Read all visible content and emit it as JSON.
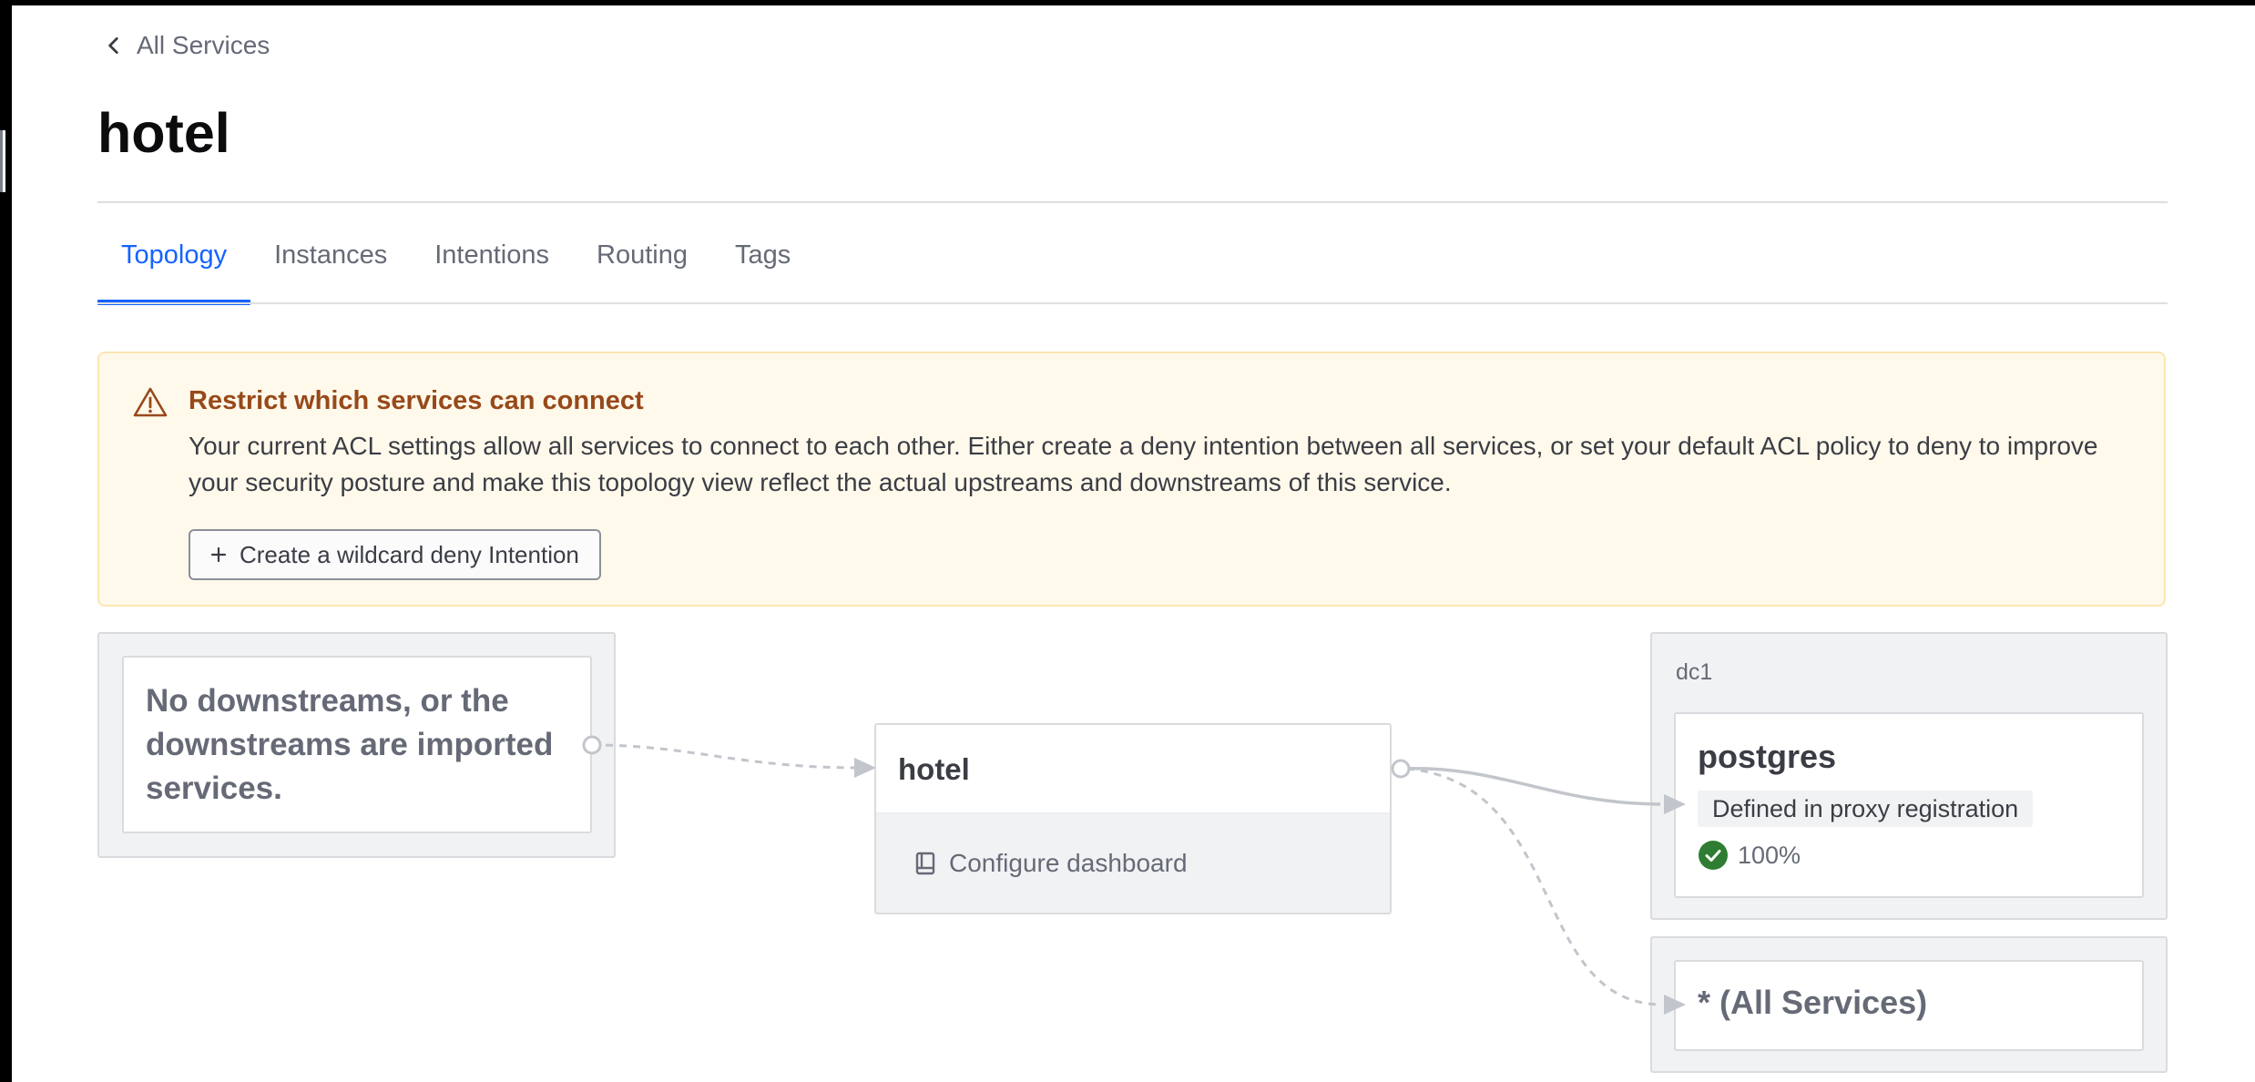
{
  "breadcrumb": {
    "label": "All Services"
  },
  "page": {
    "title": "hotel"
  },
  "tabs": [
    {
      "label": "Topology",
      "active": true
    },
    {
      "label": "Instances",
      "active": false
    },
    {
      "label": "Intentions",
      "active": false
    },
    {
      "label": "Routing",
      "active": false
    },
    {
      "label": "Tags",
      "active": false
    }
  ],
  "notice": {
    "icon": "warning-icon",
    "title": "Restrict which services can connect",
    "body": "Your current ACL settings allow all services to connect to each other. Either create a deny intention between all services, or set your default ACL policy to deny to improve your security posture and make this topology view reflect the actual upstreams and downstreams of this service.",
    "button_label": "Create a wildcard deny Intention",
    "button_icon": "plus-icon"
  },
  "topology": {
    "downstream": {
      "message": "No downstreams, or the downstreams are imported services."
    },
    "service": {
      "name": "hotel",
      "configure_label": "Configure dashboard",
      "configure_icon": "book-icon"
    },
    "upstreams": {
      "datacenter": "dc1",
      "service": {
        "name": "postgres",
        "badge": "Defined in proxy registration",
        "health": "100%",
        "health_icon": "check-circle-icon"
      },
      "wildcard": {
        "name": "* (All Services)"
      }
    }
  },
  "colors": {
    "accent": "#1563ff",
    "warning_title": "#97491a",
    "warning_bg": "#fff9eb",
    "health_ok": "#2e7d32"
  }
}
